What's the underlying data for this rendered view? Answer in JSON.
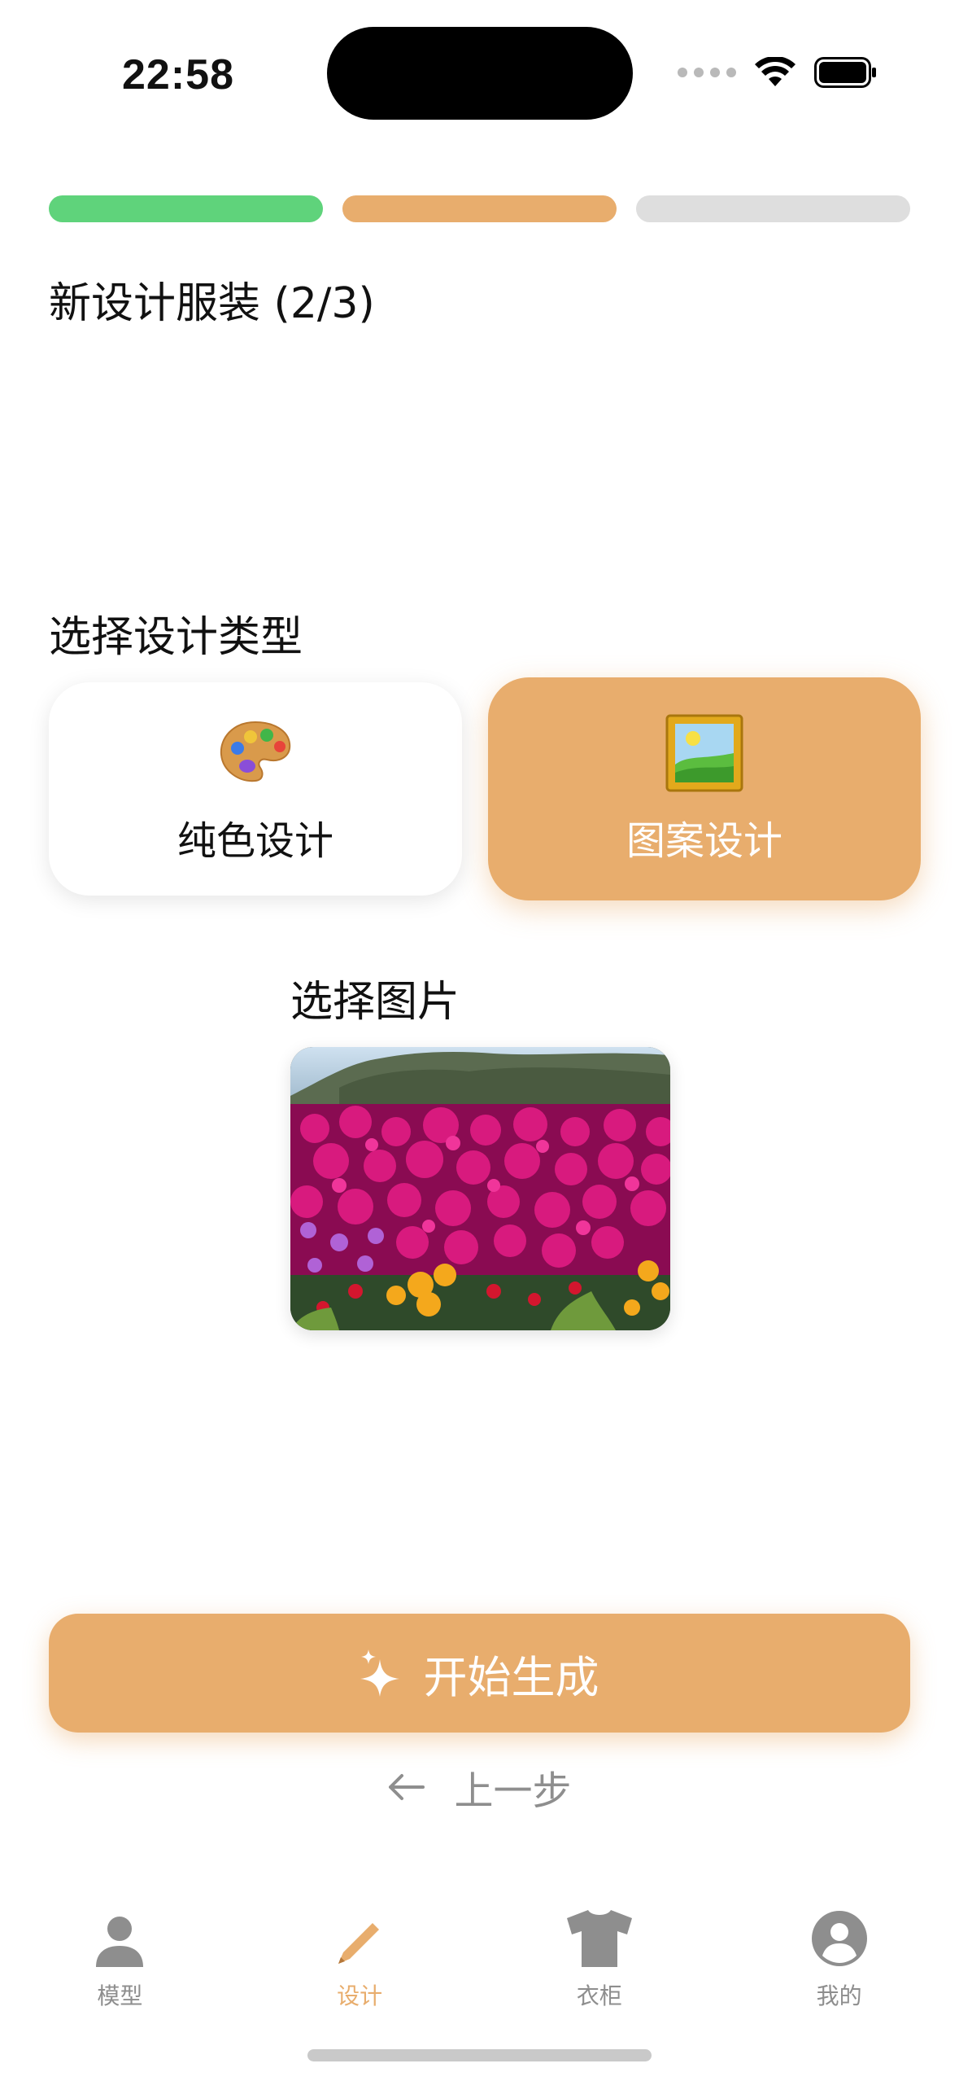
{
  "status_bar": {
    "time": "22:58"
  },
  "progress": {
    "step": 2,
    "total": 3,
    "colors": [
      "#5fd37b",
      "#e8ad6d",
      "#dedede"
    ]
  },
  "page": {
    "title": "新设计服装 (2/3)"
  },
  "design_type": {
    "label": "选择设计类型",
    "options": [
      {
        "label": "纯色设计",
        "icon": "palette-icon",
        "selected": false
      },
      {
        "label": "图案设计",
        "icon": "framed-picture-icon",
        "selected": true
      }
    ]
  },
  "image_select": {
    "label": "选择图片"
  },
  "actions": {
    "generate_label": "开始生成",
    "back_label": "上一步"
  },
  "tabbar": {
    "items": [
      {
        "label": "模型",
        "icon": "person-icon",
        "active": false
      },
      {
        "label": "设计",
        "icon": "pencil-icon",
        "active": true
      },
      {
        "label": "衣柜",
        "icon": "tshirt-icon",
        "active": false
      },
      {
        "label": "我的",
        "icon": "profile-circle-icon",
        "active": false
      }
    ]
  },
  "colors": {
    "accent": "#e8ad6d",
    "done": "#5fd37b",
    "inactive": "#8e8e8e"
  }
}
